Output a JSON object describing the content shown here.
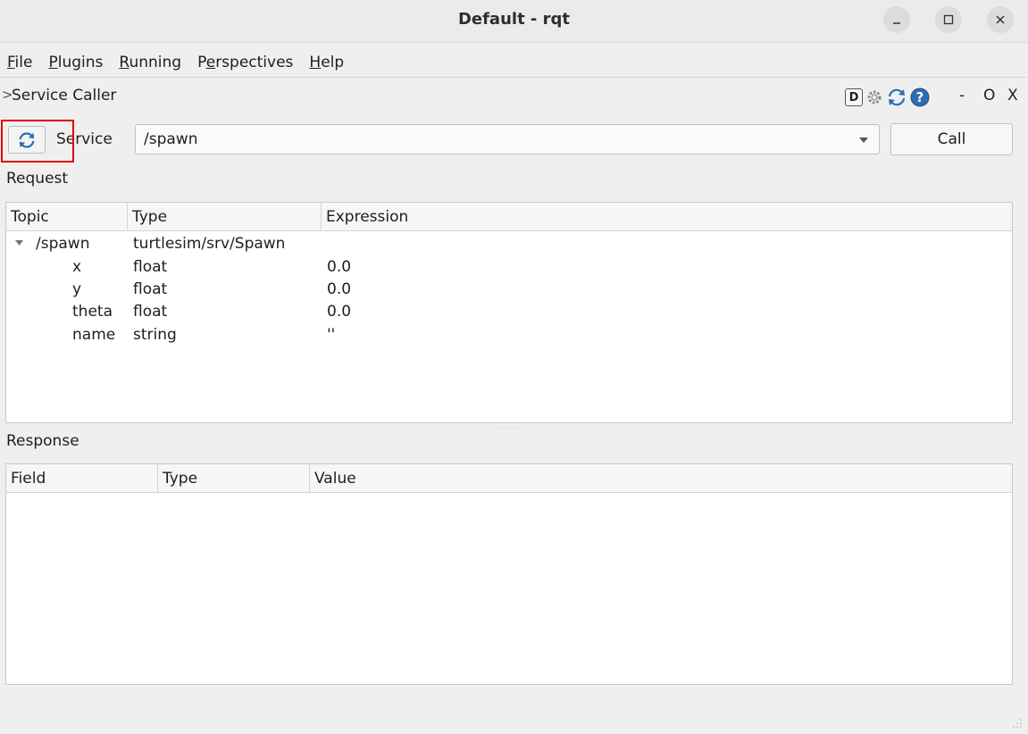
{
  "window": {
    "title": "Default - rqt"
  },
  "menu": {
    "items": [
      {
        "label": "File",
        "mnemonic": "F",
        "rest": "ile"
      },
      {
        "label": "Plugins",
        "mnemonic": "P",
        "rest": "lugins"
      },
      {
        "label": "Running",
        "mnemonic": "R",
        "rest": "unning"
      },
      {
        "label": "Perspectives",
        "pre": "P",
        "mnemonic": "e",
        "rest": "rspectives"
      },
      {
        "label": "Help",
        "mnemonic": "H",
        "rest": "elp"
      }
    ]
  },
  "plugin": {
    "title": "Service Caller",
    "arrow": ">",
    "d_label": "D",
    "min_label": "-",
    "restore_label": "O",
    "close_label": "X"
  },
  "service": {
    "label": "Service",
    "selected": "/spawn",
    "call_label": "Call"
  },
  "request": {
    "label": "Request",
    "columns": [
      "Topic",
      "Type",
      "Expression"
    ],
    "rows": [
      {
        "topic": "/spawn",
        "type": "turtlesim/srv/Spawn",
        "expression": ""
      },
      {
        "topic": "x",
        "type": "float",
        "expression": "0.0"
      },
      {
        "topic": "y",
        "type": "float",
        "expression": "0.0"
      },
      {
        "topic": "theta",
        "type": "float",
        "expression": "0.0"
      },
      {
        "topic": "name",
        "type": "string",
        "expression": "''"
      }
    ]
  },
  "response": {
    "label": "Response",
    "columns": [
      "Field",
      "Type",
      "Value"
    ]
  },
  "colors": {
    "highlight": "#e10000",
    "refresh_icon": "#2e6db4"
  },
  "icons": [
    "minimize-icon",
    "maximize-icon",
    "close-icon",
    "gear-icon",
    "refresh-icon",
    "help-icon",
    "dropdown-arrow-icon",
    "expand-arrow-icon"
  ]
}
